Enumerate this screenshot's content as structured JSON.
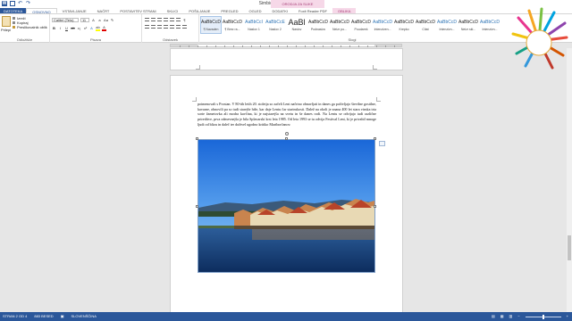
{
  "window": {
    "title": "Simbioza-kasabl3šk - Word",
    "context_group": "ORODJA ZA SLIKE"
  },
  "tabs": [
    {
      "label": "DATOTEKA",
      "kind": "file"
    },
    {
      "label": "OSNOVNO",
      "kind": "active"
    },
    {
      "label": "VSTAVLJANJE",
      "kind": "normal"
    },
    {
      "label": "NAČRT",
      "kind": "normal"
    },
    {
      "label": "POSTAVITEV STRANI",
      "kind": "normal"
    },
    {
      "label": "SKLICI",
      "kind": "normal"
    },
    {
      "label": "POŠILJANJE",
      "kind": "normal"
    },
    {
      "label": "PREGLED",
      "kind": "normal"
    },
    {
      "label": "OGLED",
      "kind": "normal"
    },
    {
      "label": "DODATKI",
      "kind": "normal"
    },
    {
      "label": "Foxit Reader PDF",
      "kind": "normal"
    },
    {
      "label": "OBLIKA",
      "kind": "ctx"
    }
  ],
  "ribbon": {
    "clipboard": {
      "paste": "Prilepi",
      "cut": "Izreži",
      "copy": "Kopiraj",
      "format_painter": "Preslikovalnik oblik",
      "label": "Odložišče"
    },
    "font": {
      "name": "Calibri (Telo)",
      "size": "11",
      "label": "Pisava"
    },
    "paragraph": {
      "label": "Odstavek"
    },
    "styles": {
      "label": "Slogi",
      "items": [
        {
          "sample": "AaBbCcDc",
          "name": "¶ Navaden",
          "kind": "normal",
          "selected": true
        },
        {
          "sample": "AaBbCcDc",
          "name": "¶ Brez ra...",
          "kind": "normal",
          "selected": false
        },
        {
          "sample": "AaBbCcI",
          "name": "Naslov 1",
          "kind": "h",
          "selected": false
        },
        {
          "sample": "AaBbCcE",
          "name": "Naslov 2",
          "kind": "h",
          "selected": false
        },
        {
          "sample": "AaBl",
          "name": "Naslov",
          "kind": "big",
          "selected": false
        },
        {
          "sample": "AaBbCcD",
          "name": "Podnaslov",
          "kind": "normal",
          "selected": false
        },
        {
          "sample": "AaBbCcDc",
          "name": "Neizr po...",
          "kind": "normal",
          "selected": false
        },
        {
          "sample": "AaBbCcDc",
          "name": "Poudarek",
          "kind": "normal",
          "selected": false
        },
        {
          "sample": "AaBbCcDc",
          "name": "Intenziven...",
          "kind": "h",
          "selected": false
        },
        {
          "sample": "AaBbCcDc",
          "name": "Krepko",
          "kind": "normal",
          "selected": false
        },
        {
          "sample": "AaBbCcDc",
          "name": "Citat",
          "kind": "normal",
          "selected": false
        },
        {
          "sample": "AaBbCcDc",
          "name": "Intenzivn...",
          "kind": "h",
          "selected": false
        },
        {
          "sample": "AaBbCcDc",
          "name": "Neizr skl...",
          "kind": "normal",
          "selected": false
        },
        {
          "sample": "AaBbCcDc",
          "name": "Intenzivn...",
          "kind": "h",
          "selected": false
        }
      ]
    }
  },
  "document": {
    "paragraph": "poimenovali s Prostan. V 80-tih letih 20. stoletja so začeli Lent načrtno obnavljati in danes ga poživljajo številne gostilne, kavarne, obnovili pa so tudi starejše hiše, kar daje Lentu čar starinskosti. Dalež na okoli je znana 400 let stara vinska trta sorte žametovka ali modra kavčina, ki je najstarejša na svetu in še danes rodi. Na Lentu se odvijajo tudi različne prireditve, prva odmevnejša je bila Splavarski krst leta 1985. Od leta 1993 se tu odvija Festival Lent, ki je privabil mnoge ljudi od blizu in daleč ter doživel ugodno kritiko Mariborčanov."
  },
  "statusbar": {
    "page": "STRAN 2 OD 4",
    "words": "883 BESED",
    "language": "SLOVENŠČINA"
  },
  "colors": {
    "accent": "#2b579a",
    "context": "#a33b74",
    "context_bg": "#f6d8e8"
  }
}
